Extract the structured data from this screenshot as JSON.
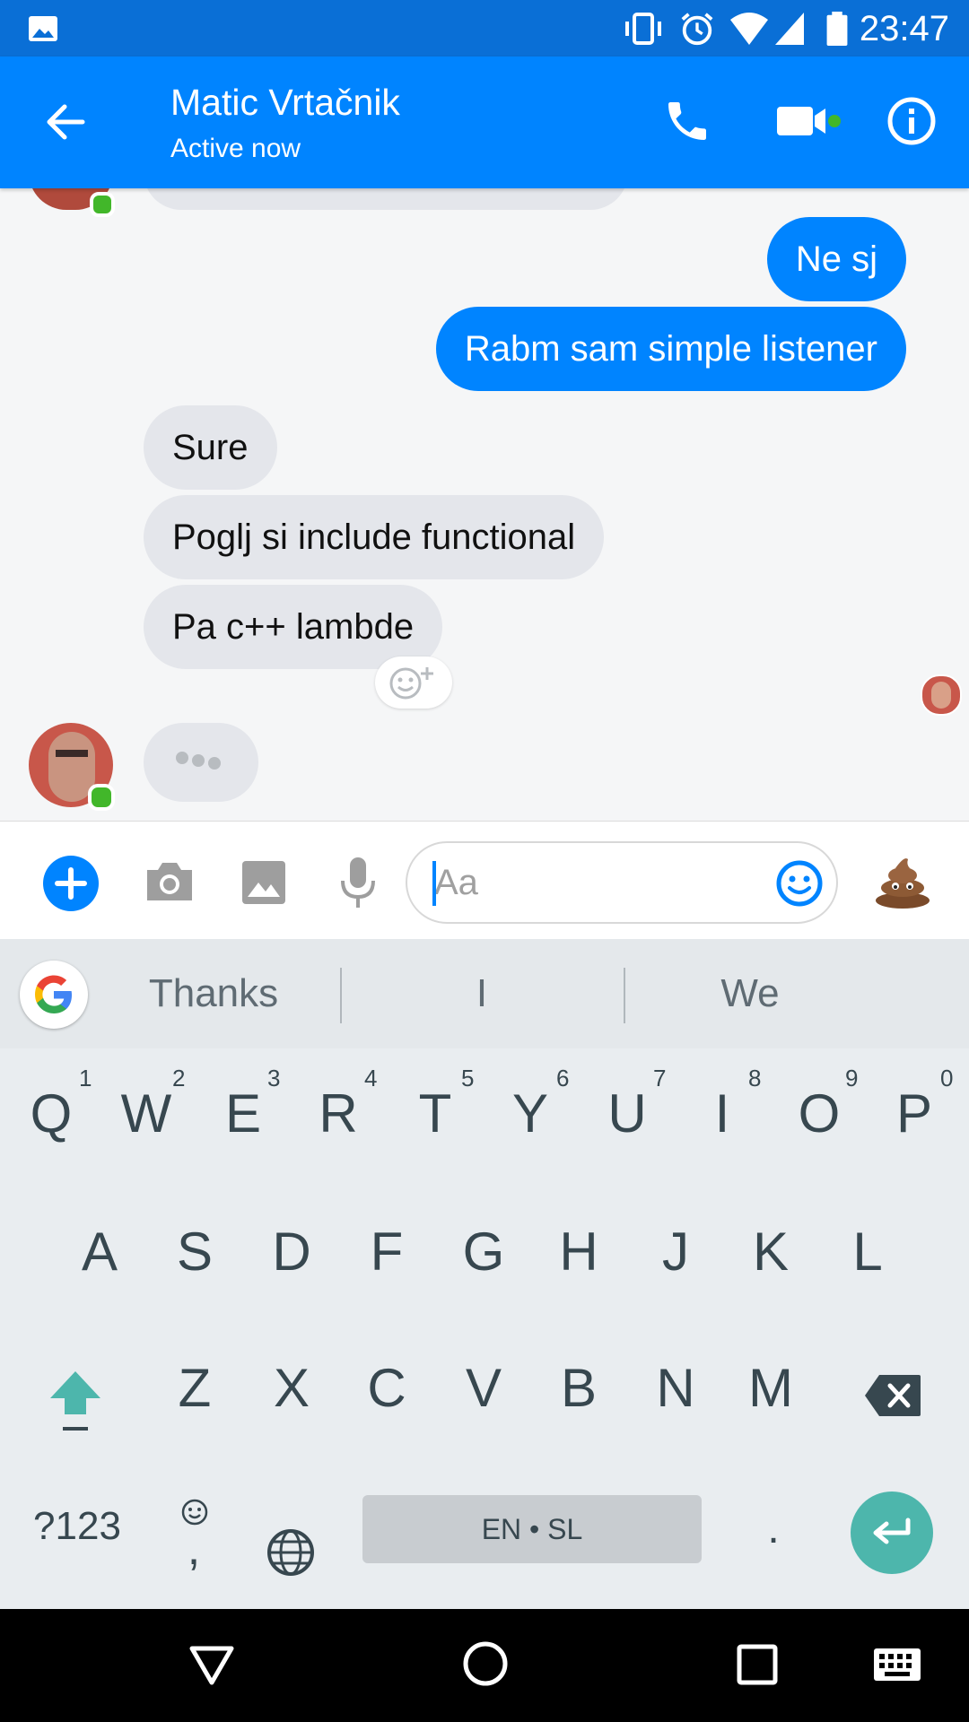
{
  "status_bar": {
    "time": "23:47",
    "icons": [
      "image-icon",
      "vibrate-icon",
      "alarm-icon",
      "wifi-icon",
      "signal-icon",
      "battery-icon"
    ]
  },
  "header": {
    "contact_name": "Matic Vrtačnik",
    "status": "Active now",
    "icons": [
      "back-arrow-icon",
      "phone-icon",
      "video-icon",
      "info-icon"
    ],
    "accent_color": "#0084ff",
    "online_color": "#42b72a"
  },
  "messages": [
    {
      "from": "me",
      "text": "Ne sj"
    },
    {
      "from": "me",
      "text": "Rabm sam simple listener"
    },
    {
      "from": "contact",
      "text": "Sure"
    },
    {
      "from": "contact",
      "text": "Poglj si include functional"
    },
    {
      "from": "contact",
      "text": "Pa c++ lambde"
    }
  ],
  "composer": {
    "placeholder": "Aa",
    "value": "",
    "icons": [
      "plus-icon",
      "camera-icon",
      "gallery-icon",
      "microphone-icon",
      "emoji-icon",
      "poop-emoji-icon"
    ]
  },
  "keyboard": {
    "suggestions": [
      "Thanks",
      "I",
      "We"
    ],
    "row1": [
      "Q",
      "W",
      "E",
      "R",
      "T",
      "Y",
      "U",
      "I",
      "O",
      "P"
    ],
    "row1_hints": [
      "1",
      "2",
      "3",
      "4",
      "5",
      "6",
      "7",
      "8",
      "9",
      "0"
    ],
    "row2": [
      "A",
      "S",
      "D",
      "F",
      "G",
      "H",
      "J",
      "K",
      "L"
    ],
    "row3": [
      "Z",
      "X",
      "C",
      "V",
      "B",
      "N",
      "M"
    ],
    "symbols_key": "?123",
    "comma_key": ",",
    "space_label": "EN • SL",
    "period_key": ".",
    "accent_color": "#4db6ac"
  },
  "nav_bar": {
    "icons": [
      "back-triangle-icon",
      "home-circle-icon",
      "recents-square-icon",
      "keyboard-switch-icon"
    ]
  }
}
